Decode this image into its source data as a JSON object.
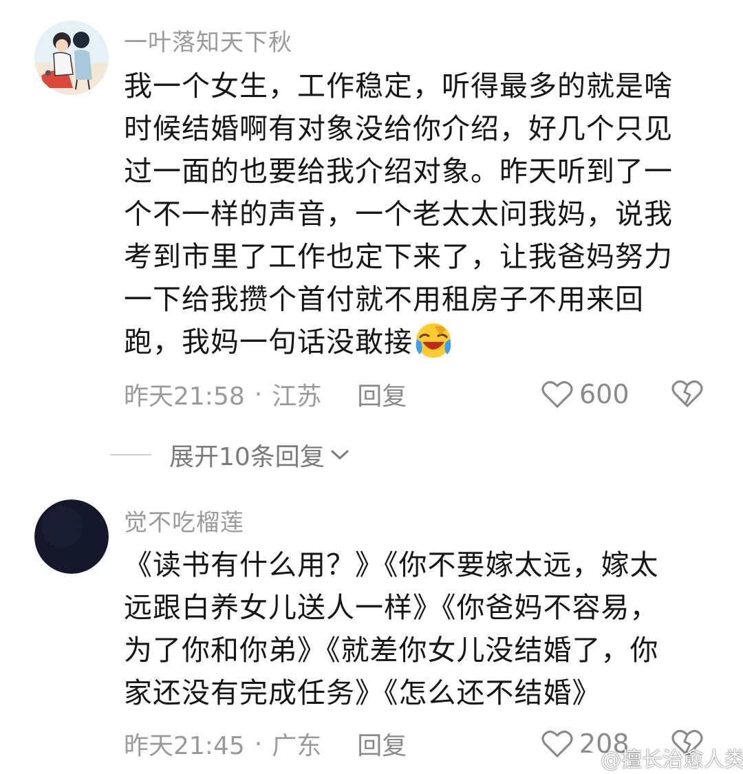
{
  "comments": [
    {
      "username": "一叶落知天下秋",
      "avatar_icon": "cartoon-couple-avatar-icon",
      "lines": [
        "我一个女生，工作稳定，听得最多的就是啥",
        "时候结婚啊有对象没给你介绍，好几个只见",
        "过一面的也要给我介绍对象。昨天听到了一",
        "个不一样的声音，一个老太太问我妈，说我",
        "考到市里了工作也定下来了，让我爸妈努力",
        "一下给我攒个首付就不用租房子不用来回",
        "跑，我妈一句话没敢接"
      ],
      "emoji": "crying-laughing-face-icon",
      "time": "昨天21:58",
      "location": "江苏",
      "separator": "·",
      "reply_label": "回复",
      "likes": "600"
    },
    {
      "username": "觉不吃榴莲",
      "avatar_icon": "dark-avatar-icon",
      "lines": [
        "《读书有什么用？》《你不要嫁太远，嫁太",
        "远跟白养女儿送人一样》《你爸妈不容易，",
        "为了你和你弟》《就差你女儿没结婚了，你",
        "家还没有完成任务》《怎么还不结婚》"
      ],
      "time": "昨天21:45",
      "location": "广东",
      "separator": "·",
      "reply_label": "回复",
      "likes": "208"
    }
  ],
  "expand_replies": "展开10条回复",
  "watermark": "@擅长治愈人类",
  "colors": {
    "text": "#161616",
    "muted": "#9a9a9a",
    "background": "#ffffff"
  }
}
